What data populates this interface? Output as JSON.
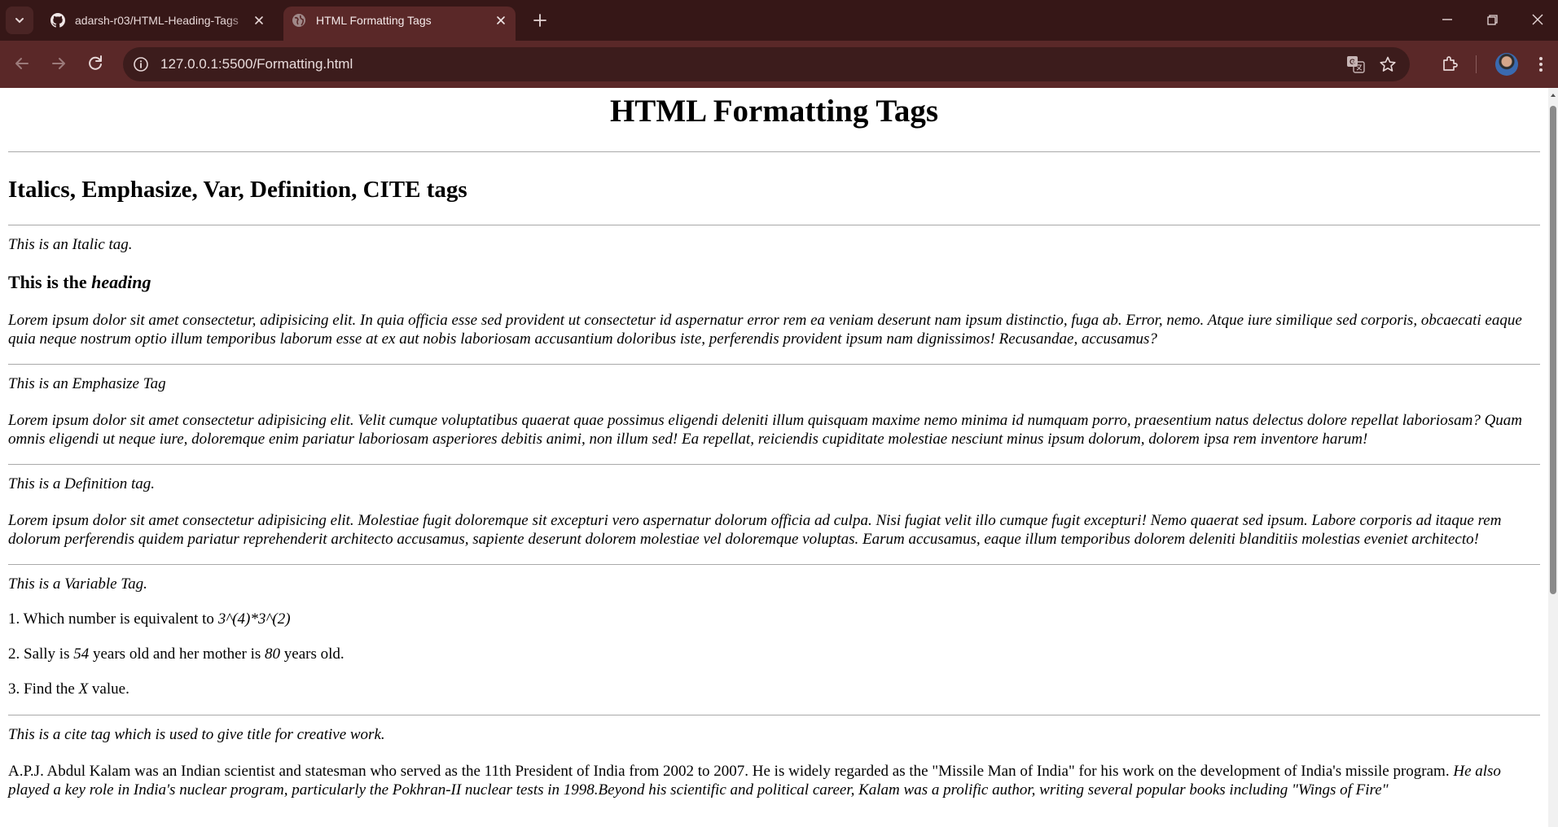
{
  "browser": {
    "tabs": [
      {
        "title": "adarsh-r03/HTML-Heading-Tags",
        "icon": "github-icon",
        "active": false
      },
      {
        "title": "HTML Formatting Tags",
        "icon": "globe-icon",
        "active": true
      }
    ],
    "url": "127.0.0.1:5500/Formatting.html",
    "colors": {
      "tabstrip": "#361717",
      "toolbar": "#5a2828",
      "omnibox": "#3c1c1c"
    }
  },
  "page": {
    "title": "HTML Formatting Tags",
    "section_heading": "Italics, Emphasize, Var, Definition, CITE tags",
    "italic_intro": "This is an Italic tag.",
    "heading_plain": "This is the ",
    "heading_italic": "heading",
    "italic_para": "Lorem ipsum dolor sit amet consectetur, adipisicing elit. In quia officia esse sed provident ut consectetur id aspernatur error rem ea veniam deserunt nam ipsum distinctio, fuga ab. Error, nemo. Atque iure similique sed corporis, obcaecati eaque quia neque nostrum optio illum temporibus laborum esse at ex aut nobis laboriosam accusantium doloribus iste, perferendis provident ipsum nam dignissimos! Recusandae, accusamus?",
    "emphasize_label": "This is an Emphasize Tag",
    "emphasize_para": "Lorem ipsum dolor sit amet consectetur adipisicing elit. Velit cumque voluptatibus quaerat quae possimus eligendi deleniti illum quisquam maxime nemo minima id numquam porro, praesentium natus delectus dolore repellat laboriosam? Quam omnis eligendi ut neque iure, doloremque enim pariatur laboriosam asperiores debitis animi, non illum sed! Ea repellat, reiciendis cupiditate molestiae nesciunt minus ipsum dolorum, dolorem ipsa rem inventore harum!",
    "definition_label": "This is a Definition tag.",
    "definition_para": "Lorem ipsum dolor sit amet consectetur adipisicing elit. Molestiae fugit doloremque sit excepturi vero aspernatur dolorum officia ad culpa. Nisi fugiat velit illo cumque fugit excepturi! Nemo quaerat sed ipsum. Labore corporis ad itaque rem dolorum perferendis quidem pariatur reprehenderit architecto accusamus, sapiente deserunt dolorem molestiae vel doloremque voluptas. Earum accusamus, eaque illum temporibus dolorem deleniti blanditiis molestias eveniet architecto!",
    "variable_label": "This is a Variable Tag.",
    "q1_text": "1. Which number is equivalent to ",
    "q1_var": "3^(4)*3^(2)",
    "q2_a": "2. Sally is ",
    "q2_var1": "54",
    "q2_b": " years old and her mother is ",
    "q2_var2": "80",
    "q2_c": " years old.",
    "q3_a": "3. Find the ",
    "q3_var": "X",
    "q3_b": " value.",
    "cite_label": "This is a cite tag which is used to give title for creative work.",
    "cite_para_plain": "A.P.J. Abdul Kalam was an Indian scientist and statesman who served as the 11th President of India from 2002 to 2007. He is widely regarded as the \"Missile Man of India\" for his work on the development of India's missile program.",
    "cite_para_italic": " He also played a key role in India's nuclear program, particularly the Pokhran-II nuclear tests in 1998.Beyond his scientific and political career, Kalam was a prolific author, writing several popular books including \"Wings of Fire\""
  }
}
